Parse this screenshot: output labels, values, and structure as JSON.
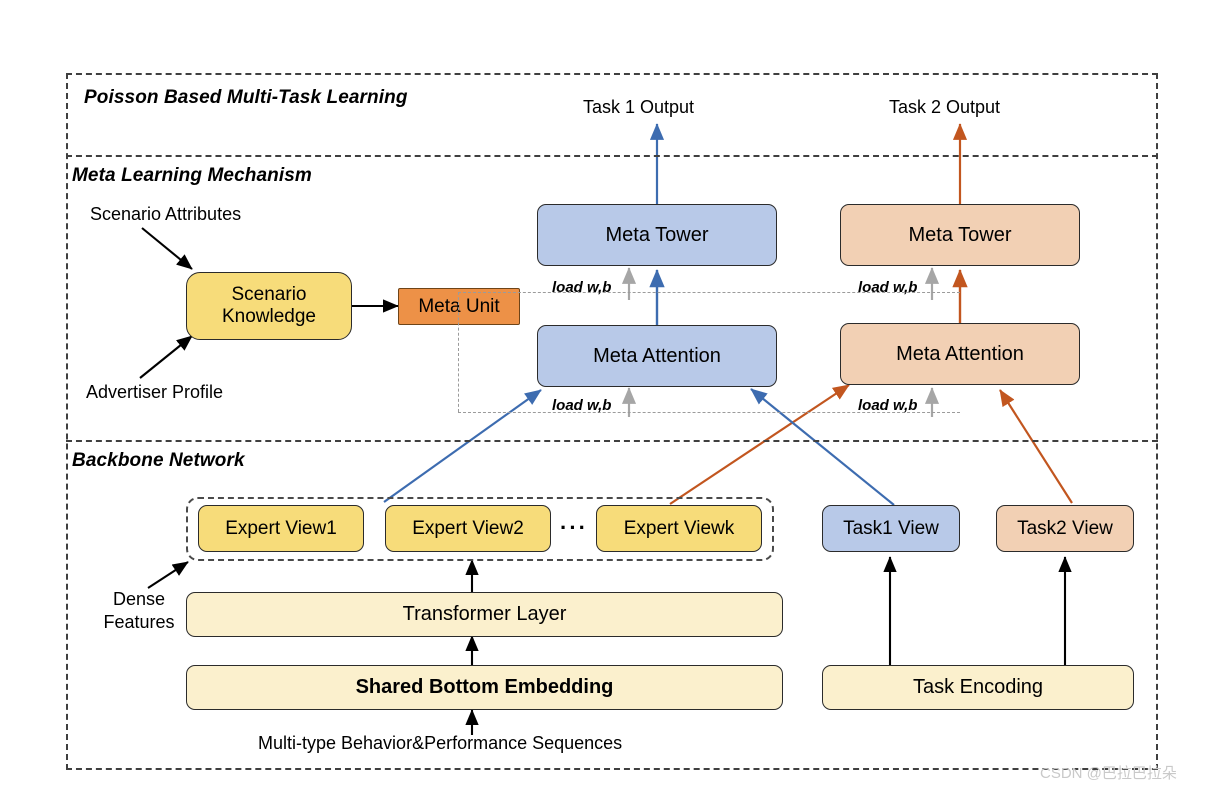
{
  "figure": {
    "sections": [
      {
        "id": "poisson",
        "title": "Poisson Based Multi-Task Learning"
      },
      {
        "id": "meta",
        "title": "Meta Learning Mechanism"
      },
      {
        "id": "backbone",
        "title": "Backbone Network"
      }
    ],
    "outputs": [
      {
        "id": "task1_output",
        "label": "Task 1 Output"
      },
      {
        "id": "task2_output",
        "label": "Task 2 Output"
      }
    ],
    "meta_section": {
      "inputs": [
        {
          "id": "scenario_attributes",
          "label": "Scenario Attributes"
        },
        {
          "id": "advertiser_profile",
          "label": "Advertiser Profile"
        }
      ],
      "scenario_knowledge": {
        "line1": "Scenario",
        "line2": "Knowledge"
      },
      "meta_unit": {
        "label": "Meta Unit"
      },
      "columns": [
        {
          "id": "task1",
          "tower": "Meta Tower",
          "attention": "Meta Attention",
          "color": "#b8c9e8"
        },
        {
          "id": "task2",
          "tower": "Meta Tower",
          "attention": "Meta Attention",
          "color": "#f2d0b4"
        }
      ],
      "load_labels": [
        "load w,b",
        "load w,b",
        "load w,b",
        "load w,b"
      ]
    },
    "backbone": {
      "dense_features": {
        "line1": "Dense",
        "line2": "Features"
      },
      "experts": [
        {
          "id": "expert1",
          "label": "Expert View1"
        },
        {
          "id": "expert2",
          "label": "Expert View2"
        },
        {
          "id": "expertk",
          "label": "Expert Viewk"
        }
      ],
      "expert_ellipsis": "···",
      "task_views": [
        {
          "id": "task1_view",
          "label": "Task1 View",
          "color": "#b8c9e8"
        },
        {
          "id": "task2_view",
          "label": "Task2 View",
          "color": "#f2d0b4"
        }
      ],
      "transformer_layer": {
        "label": "Transformer Layer"
      },
      "shared_bottom": {
        "label": "Shared Bottom Embedding"
      },
      "task_encoding": {
        "label": "Task Encoding"
      },
      "input_caption": {
        "label": "Multi-type Behavior&Performance Sequences"
      }
    },
    "watermark": {
      "label": "CSDN @巴拉巴拉朵"
    },
    "colors": {
      "blue": "#b8c9e8",
      "peach": "#f2d0b4",
      "yellow": "#f7dc7a",
      "cream": "#fbf0cd",
      "orange": "#ed9147",
      "blue_arrow": "#3d6cb0",
      "orange_arrow": "#c2561f",
      "gray_arrow": "#a6a6a6",
      "black": "#000000"
    }
  }
}
